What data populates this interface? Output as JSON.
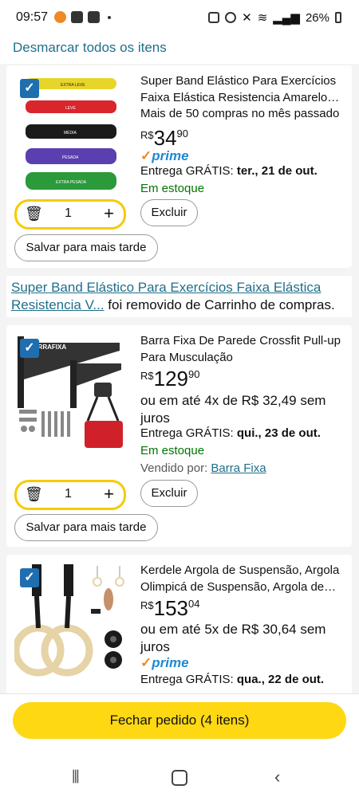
{
  "status_bar": {
    "time": "09:57",
    "battery": "26%"
  },
  "deselect_all": "Desmarcar todos os itens",
  "items": [
    {
      "title": "Super Band Elástico Para Exercícios Faixa Elástica Resistencia Amarelo…",
      "purchases": "Mais de 50 compras no mês passado",
      "currency": "R$",
      "price_int": "34",
      "price_cents": "90",
      "prime": "prime",
      "delivery_prefix": "Entrega GRÁTIS:",
      "delivery_date": "ter., 21 de out.",
      "stock": "Em estoque",
      "qty": "1",
      "delete_label": "Excluir",
      "save_label": "Salvar para mais tarde",
      "band_labels": [
        "EXTRA LEVE",
        "LEVE",
        "MÉDIA",
        "PESADA",
        "EXTRA PESADA"
      ]
    },
    {
      "title": "Barra Fixa De Parede Crossfit Pull-up Para Musculação",
      "currency": "R$",
      "price_int": "129",
      "price_cents": "90",
      "installments": "ou em até 4x de R$ 32,49 sem juros",
      "delivery_prefix": "Entrega GRÁTIS:",
      "delivery_date": "qui., 23 de out.",
      "stock": "Em estoque",
      "seller_prefix": "Vendido por:",
      "seller": "Barra Fixa",
      "qty": "1",
      "delete_label": "Excluir",
      "save_label": "Salvar para mais tarde",
      "brand_mark": "BARRAFIXA"
    },
    {
      "title": "Kerdele Argola de Suspensão, Argola Olimpicá de Suspensão, Argola de…",
      "currency": "R$",
      "price_int": "153",
      "price_cents": "04",
      "installments": "ou em até 5x de R$ 30,64 sem juros",
      "prime": "prime",
      "delivery_prefix": "Entrega GRÁTIS:",
      "delivery_date": "qua., 22 de out."
    }
  ],
  "removed_notice": {
    "link": "Super Band Elástico Para Exercícios Faixa Elástica Resistencia V...",
    "text": " foi removido de Carrinho de compras."
  },
  "checkout_button": "Fechar pedido (4 itens)",
  "colors": {
    "accent_yellow": "#ffd814",
    "link_blue": "#1f6f8b",
    "stock_green": "#007600",
    "checkbox_blue": "#1f6fb0"
  }
}
